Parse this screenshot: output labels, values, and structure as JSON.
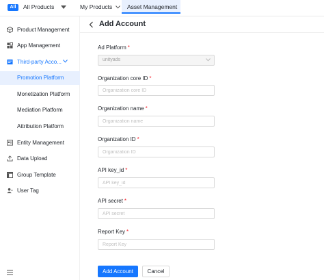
{
  "topbar": {
    "all_badge": "All",
    "all_products": "All Products",
    "my_products": "My Products",
    "asset_management": "Asset Management"
  },
  "sidebar": {
    "items": [
      {
        "label": "Product Management",
        "icon": "cube-icon"
      },
      {
        "label": "App Management",
        "icon": "apps-icon"
      },
      {
        "label": "Third-party Acco...",
        "icon": "account-icon",
        "expanded": true
      },
      {
        "label": "Promotion Platform",
        "selected": true
      },
      {
        "label": "Monetization Platform"
      },
      {
        "label": "Mediation Platform"
      },
      {
        "label": "Attribution Platform"
      },
      {
        "label": "Entity Management",
        "icon": "entity-icon"
      },
      {
        "label": "Data Upload",
        "icon": "upload-icon"
      },
      {
        "label": "Group Template",
        "icon": "template-icon"
      },
      {
        "label": "User Tag",
        "icon": "user-tag-icon"
      }
    ],
    "accent": "#1677ff"
  },
  "main": {
    "title": "Add Account",
    "fields": [
      {
        "label": "Ad Platform",
        "value": "unityads",
        "type": "select-disabled"
      },
      {
        "label": "Organization core ID",
        "placeholder": "Organization core ID"
      },
      {
        "label": "Organization name",
        "placeholder": "Organization name"
      },
      {
        "label": "Organization ID",
        "placeholder": "Organization ID"
      },
      {
        "label": "API key_id",
        "placeholder": "API key_id"
      },
      {
        "label": "API secret",
        "placeholder": "API secret"
      },
      {
        "label": "Report Key",
        "placeholder": "Report Key"
      }
    ],
    "required_mark": "*",
    "submit_label": "Add Account",
    "cancel_label": "Cancel"
  }
}
